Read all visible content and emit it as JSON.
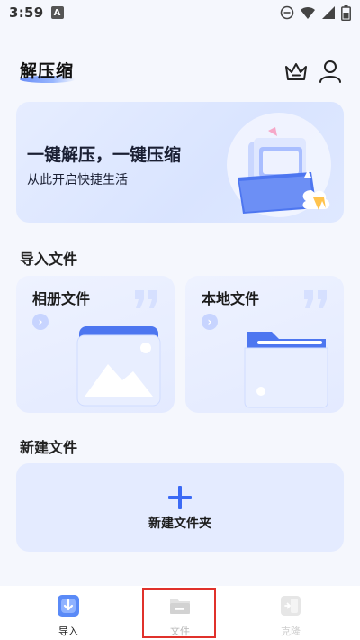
{
  "status_bar": {
    "time": "3:59",
    "sim_badge": "A",
    "icons": [
      "do-not-disturb-icon",
      "wifi-icon",
      "signal-icon",
      "battery-icon"
    ]
  },
  "header": {
    "title": "解压缩",
    "icons": [
      "crown-icon",
      "user-icon"
    ]
  },
  "banner": {
    "title": "一键解压，一键压缩",
    "subtitle": "从此开启快捷生活"
  },
  "import_section": {
    "title": "导入文件",
    "cards": [
      {
        "label": "相册文件",
        "icon": "photo-folder-icon"
      },
      {
        "label": "本地文件",
        "icon": "local-folder-icon"
      }
    ]
  },
  "create_section": {
    "title": "新建文件",
    "button_label": "新建文件夹",
    "icon": "plus-icon"
  },
  "tabbar": {
    "items": [
      {
        "label": "导入",
        "icon": "import-icon",
        "state": "active"
      },
      {
        "label": "文件",
        "icon": "folder-icon",
        "state": "inactive"
      },
      {
        "label": "克隆",
        "icon": "clone-icon",
        "state": "inactive"
      }
    ]
  },
  "colors": {
    "accent": "#3b6af5",
    "background": "#f5f7fd",
    "card": "#e4ebff",
    "highlight": "#e0312b"
  }
}
